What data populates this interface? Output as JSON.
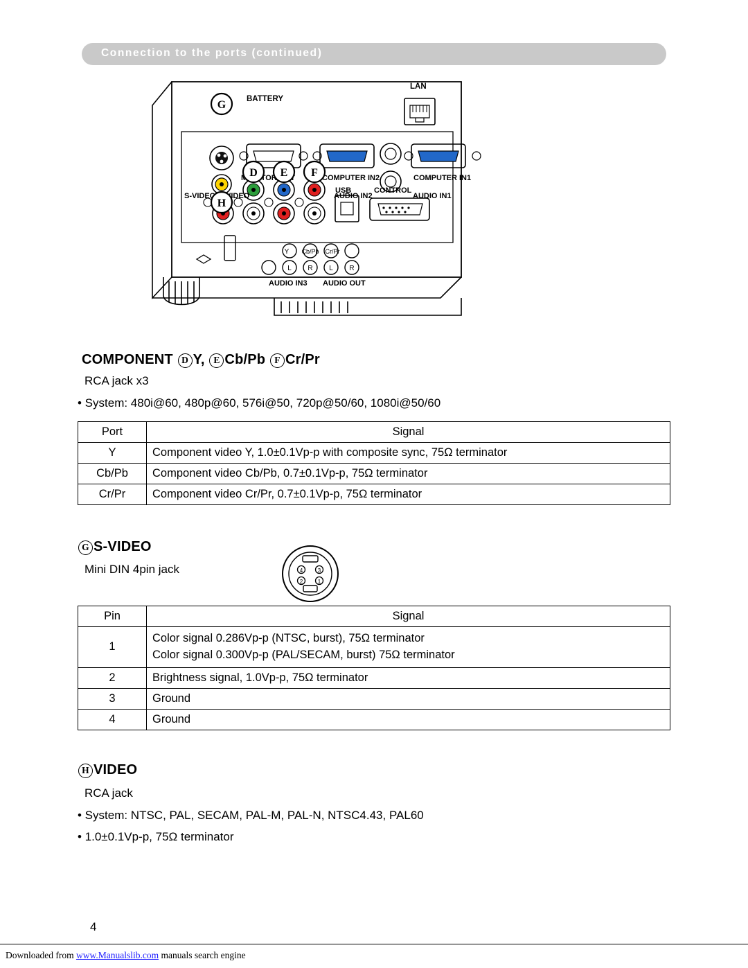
{
  "header": {
    "title": "Connection to the ports (continued)"
  },
  "illustration": {
    "name": "projector-rear-ports-diagram",
    "labels": {
      "battery": "BATTERY",
      "lan": "LAN",
      "computer_in2": "COMPUTER IN2",
      "computer_in1": "COMPUTER IN1",
      "monitor_out": "MONITOR OUT",
      "audio_in2": "AUDIO IN2",
      "audio_in1": "AUDIO IN1",
      "s_video": "S-VIDEO",
      "video": "VIDEO",
      "usb": "USB",
      "control": "CONTROL",
      "audio_in3": "AUDIO IN3",
      "audio_out": "AUDIO OUT",
      "y": "Y",
      "cb_pb": "Cb/Pb",
      "cr_pr": "Cr/Pr",
      "l1": "L",
      "r1": "R",
      "l2": "L",
      "r2": "R"
    },
    "callouts": {
      "g": "G",
      "h": "H",
      "d": "D",
      "e": "E",
      "f": "F"
    }
  },
  "component": {
    "title_prefix": "COMPONENT ",
    "letter_d": "D",
    "label_y": "Y,",
    "letter_e": "E",
    "label_cbpb": "Cb/Pb",
    "letter_f": "F",
    "label_crpr": "Cr/Pr",
    "jack": "RCA jack x3",
    "system": "• System: 480i@60, 480p@60, 576i@50, 720p@50/60, 1080i@50/60",
    "table": {
      "headers": [
        "Port",
        "Signal"
      ],
      "rows": [
        [
          "Y",
          "Component video Y, 1.0±0.1Vp-p with composite sync, 75Ω terminator"
        ],
        [
          "Cb/Pb",
          "Component video Cb/Pb, 0.7±0.1Vp-p, 75Ω terminator"
        ],
        [
          "Cr/Pr",
          "Component video Cr/Pr, 0.7±0.1Vp-p, 75Ω terminator"
        ]
      ]
    }
  },
  "svideo": {
    "letter": "G",
    "title": "S-VIDEO",
    "jack": "Mini DIN 4pin jack",
    "jack_pins": [
      "4",
      "3",
      "2",
      "1"
    ],
    "table": {
      "headers": [
        "Pin",
        "Signal"
      ],
      "rows": [
        {
          "pin": "1",
          "lines": [
            "Color signal 0.286Vp-p (NTSC, burst), 75Ω terminator",
            "Color signal 0.300Vp-p (PAL/SECAM, burst) 75Ω terminator"
          ]
        },
        {
          "pin": "2",
          "lines": [
            "Brightness signal, 1.0Vp-p, 75Ω terminator"
          ]
        },
        {
          "pin": "3",
          "lines": [
            "Ground"
          ]
        },
        {
          "pin": "4",
          "lines": [
            "Ground"
          ]
        }
      ]
    }
  },
  "video": {
    "letter": "H",
    "title": "VIDEO",
    "jack": "RCA jack",
    "system": "• System: NTSC, PAL, SECAM, PAL-M, PAL-N, NTSC4.43, PAL60",
    "spec": "• 1.0±0.1Vp-p, 75Ω terminator"
  },
  "footer": {
    "page_number": "4",
    "downloaded_prefix": "Downloaded from ",
    "link": "www.Manualslib.com",
    "downloaded_suffix": " manuals search engine"
  }
}
